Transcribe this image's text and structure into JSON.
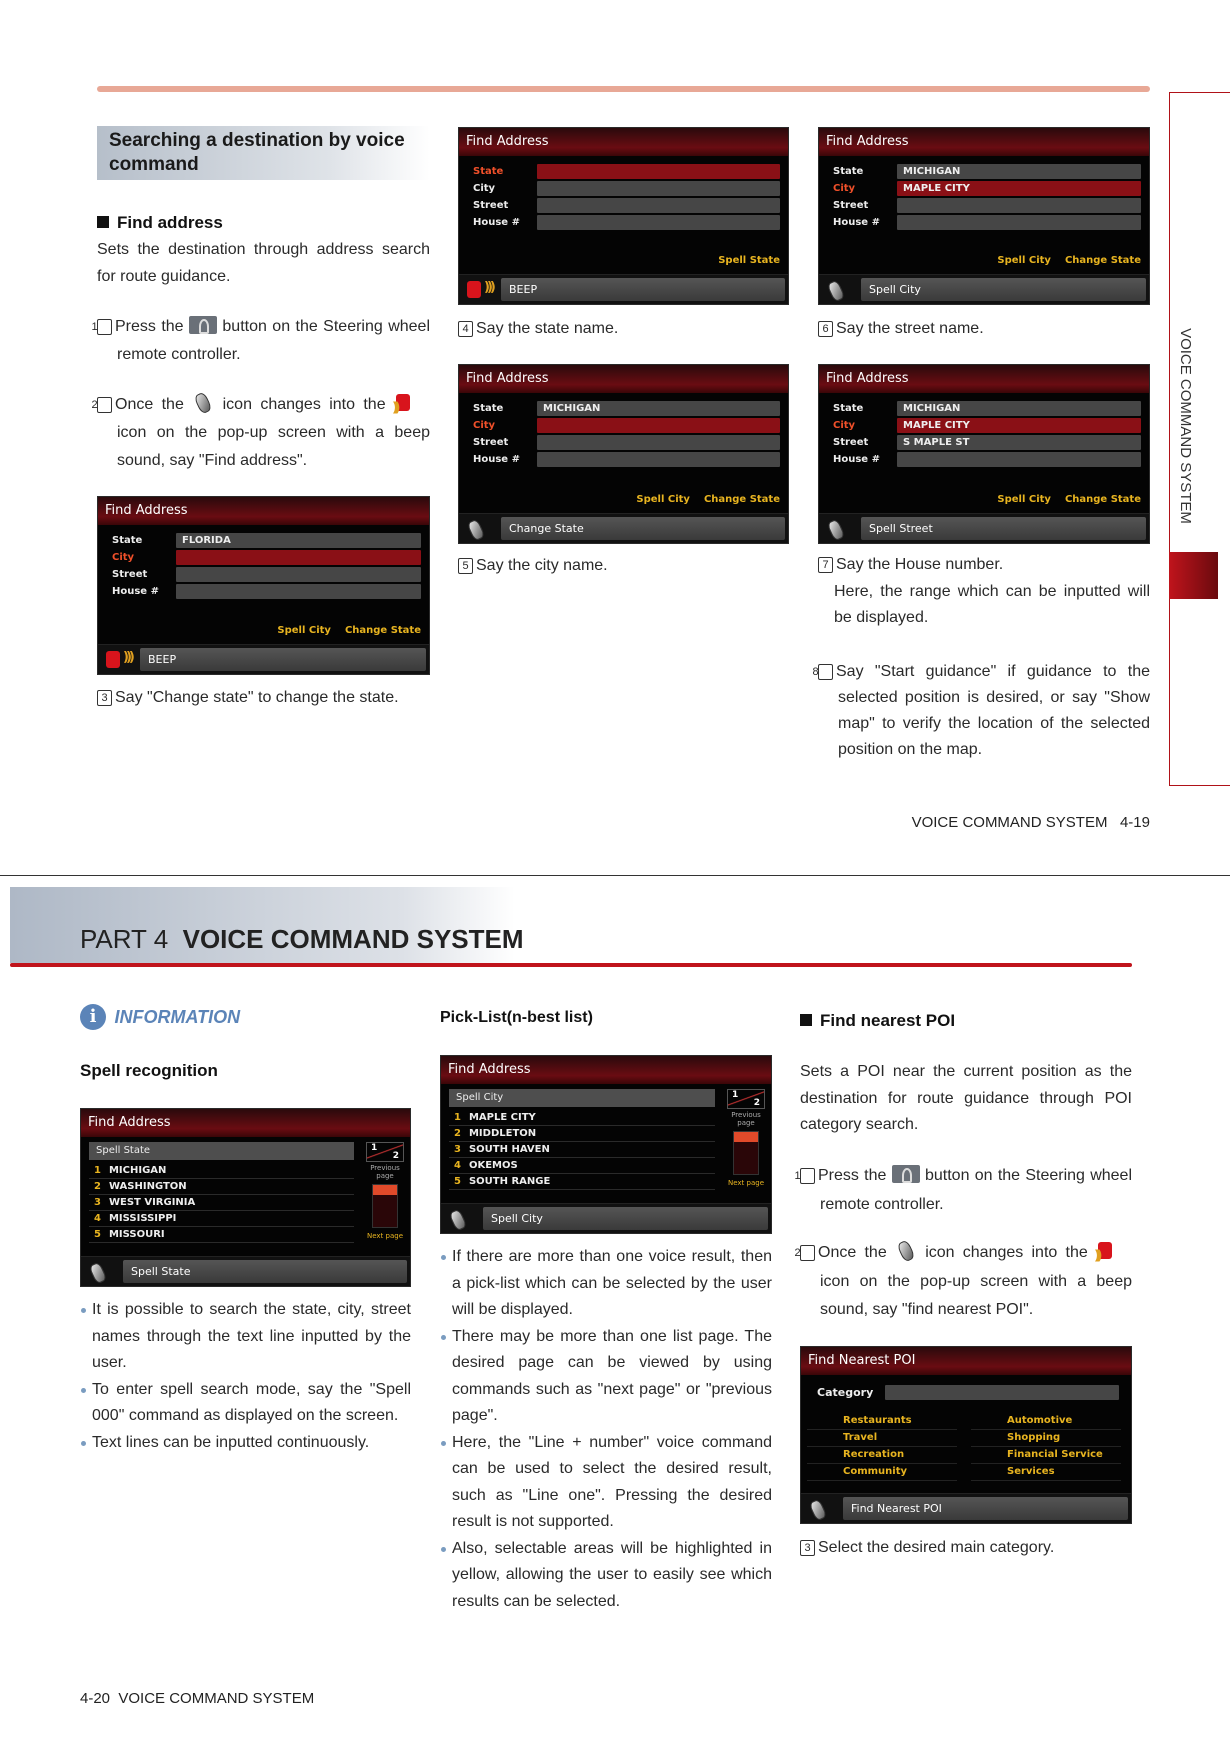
{
  "page_top": {
    "section_title": "Searching a destination by voice command",
    "find_address": {
      "heading": "Find address",
      "intro": "Sets the destination through address search for route guidance.",
      "step1_num": "1",
      "step1_a": "Press the",
      "step1_b": "button on the Steering wheel remote controller.",
      "step2_num": "2",
      "step2_a": "Once the",
      "step2_b": "icon changes into the",
      "step2_c": "icon on the pop-up screen with a beep sound, say \"Find address\".",
      "step3_num": "3",
      "step3": "Say \"Change state\" to change the state.",
      "step4_num": "4",
      "step4": "Say the state name.",
      "step5_num": "5",
      "step5": "Say the city name.",
      "step6_num": "6",
      "step6": "Say the street name.",
      "step7_num": "7",
      "step7": "Say the House number.",
      "step7_note": "Here, the range which can be inputted will be displayed.",
      "step8_num": "8",
      "step8": "Say \"Start guidance\" if guidance to the selected position is desired, or say \"Show map\" to verify the location of the selected position on the map."
    },
    "side_tab": "VOICE COMMAND SYSTEM",
    "footer": "VOICE COMMAND SYSTEM",
    "page_number": "4-19"
  },
  "page_bottom": {
    "part_label": "PART 4",
    "part_title": "VOICE COMMAND SYSTEM",
    "information_label": "INFORMATION",
    "spell_heading": "Spell recognition",
    "spell_bullets": [
      "It is possible to search the state, city, street names through the text line inputted by the user.",
      "To enter spell search mode, say the \"Spell 000\" command as displayed on the screen.",
      "Text lines can be inputted continuously."
    ],
    "picklist_heading": "Pick-List(n-best list)",
    "picklist_bullets": [
      "If there are more than one voice result, then a pick-list which can be selected by the user will be displayed.",
      "There may be more than one list page. The desired page can be viewed by using commands such as \"next page\" or \"previous page\".",
      "Here, the \"Line + number\" voice command can be used to select the desired result, such as \"Line one\". Pressing the desired result is not supported.",
      "Also, selectable areas will be highlighted in yellow, allowing the user to easily see which results can be selected."
    ],
    "poi": {
      "heading": "Find nearest POI",
      "intro": "Sets a POI near the current position as the destination for route guidance through POI category search.",
      "step1_num": "1",
      "step1_a": "Press the",
      "step1_b": "button on the Steering wheel remote controller.",
      "step2_num": "2",
      "step2_a": "Once the",
      "step2_b": "icon changes into the",
      "step2_c": "icon on the pop-up screen with a beep sound, say \"find nearest POI\".",
      "step3_num": "3",
      "step3": "Select the desired main category."
    },
    "footer_page": "4-20",
    "footer": "VOICE COMMAND SYSTEM"
  },
  "screens": {
    "s3": {
      "type": "form",
      "title": "Find Address",
      "fields": [
        {
          "label": "State",
          "value": "FLORIDA"
        },
        {
          "label": "City",
          "value": "",
          "active": true
        },
        {
          "label": "Street",
          "value": ""
        },
        {
          "label": "House #",
          "value": ""
        }
      ],
      "options": [
        "Spell City",
        "Change State"
      ],
      "bar_icon": "beep",
      "bar_text": "BEEP"
    },
    "s4": {
      "type": "form",
      "title": "Find Address",
      "fields": [
        {
          "label": "State",
          "value": "",
          "active": true
        },
        {
          "label": "City",
          "value": ""
        },
        {
          "label": "Street",
          "value": ""
        },
        {
          "label": "House #",
          "value": ""
        }
      ],
      "options": [
        "Spell State"
      ],
      "bar_icon": "beep",
      "bar_text": "BEEP"
    },
    "s5": {
      "type": "form",
      "title": "Find Address",
      "fields": [
        {
          "label": "State",
          "value": "MICHIGAN"
        },
        {
          "label": "City",
          "value": "",
          "active": true
        },
        {
          "label": "Street",
          "value": ""
        },
        {
          "label": "House #",
          "value": ""
        }
      ],
      "options": [
        "Spell City",
        "Change State"
      ],
      "bar_icon": "mic",
      "bar_text": "Change State"
    },
    "s6": {
      "type": "form",
      "title": "Find Address",
      "fields": [
        {
          "label": "State",
          "value": "MICHIGAN"
        },
        {
          "label": "City",
          "value": "MAPLE CITY",
          "active": true
        },
        {
          "label": "Street",
          "value": ""
        },
        {
          "label": "House #",
          "value": ""
        }
      ],
      "options": [
        "Spell City",
        "Change State"
      ],
      "bar_icon": "mic",
      "bar_text": "Spell City"
    },
    "s7": {
      "type": "form",
      "title": "Find Address",
      "fields": [
        {
          "label": "State",
          "value": "MICHIGAN"
        },
        {
          "label": "City",
          "value": "MAPLE CITY",
          "active": true
        },
        {
          "label": "Street",
          "value": "S MAPLE ST"
        },
        {
          "label": "House #",
          "value": ""
        }
      ],
      "options": [
        "Spell City",
        "Change State"
      ],
      "bar_icon": "mic",
      "bar_text": "Spell Street"
    },
    "spell": {
      "type": "pick",
      "title": "Find Address",
      "header": "Spell State",
      "items": [
        "MICHIGAN",
        "WASHINGTON",
        "WEST VIRGINIA",
        "MISSISSIPPI",
        "MISSOURI"
      ],
      "page_current": "1",
      "page_total": "2",
      "prev_label": "Previous page",
      "next_label": "Next page",
      "bar_icon": "mic",
      "bar_text": "Spell State"
    },
    "pick": {
      "type": "pick",
      "title": "Find Address",
      "header": "Spell City",
      "items": [
        "MAPLE CITY",
        "MIDDLETON",
        "SOUTH HAVEN",
        "OKEMOS",
        "SOUTH RANGE"
      ],
      "page_current": "1",
      "page_total": "2",
      "prev_label": "Previous page",
      "next_label": "Next page",
      "bar_icon": "mic",
      "bar_text": "Spell City"
    },
    "poi": {
      "type": "poi",
      "title": "Find Nearest POI",
      "category_label": "Category",
      "categories": [
        "Restaurants",
        "Automotive",
        "Travel",
        "Shopping",
        "Recreation",
        "Financial Service",
        "Community",
        "Services"
      ],
      "bar_icon": "mic",
      "bar_text": "Find Nearest POI"
    }
  },
  "colors": {
    "accent_red": "#b01218",
    "salmon_rule": "#e8a896",
    "option_yellow": "#e8b420",
    "info_blue": "#5b84b8"
  }
}
